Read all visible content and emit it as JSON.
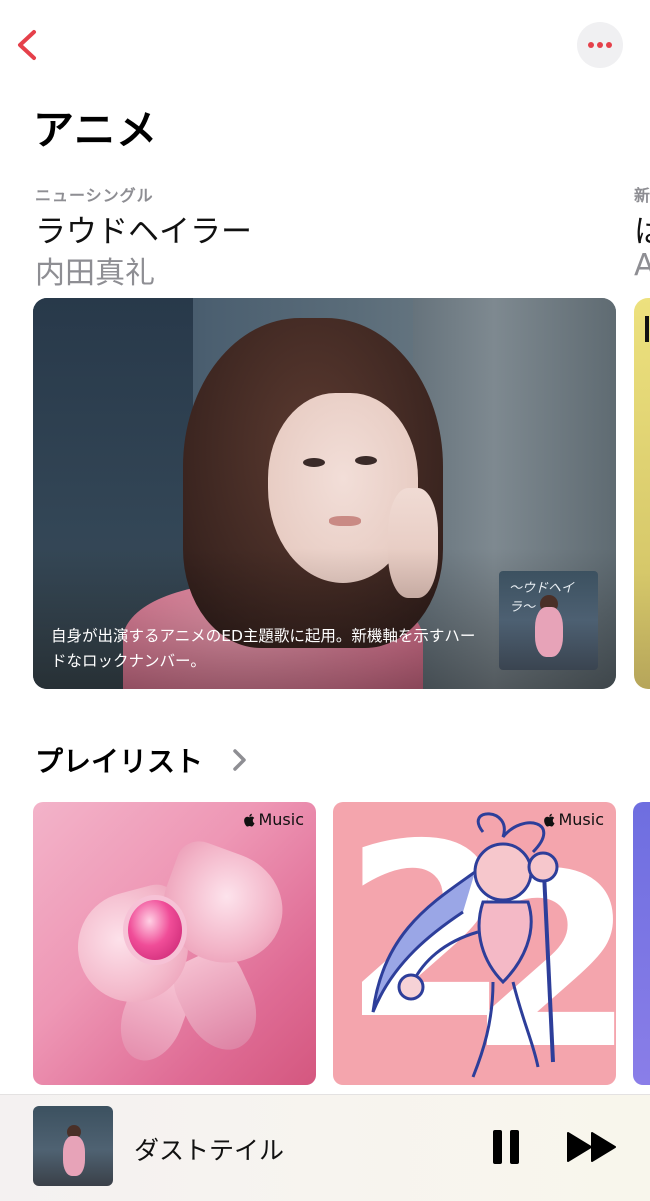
{
  "header": {
    "back_icon": "chevron-left-icon",
    "more_icon": "ellipsis-icon",
    "accent_color": "#e5404a",
    "title": "アニメ"
  },
  "featured": {
    "eyebrow": "ニューシングル",
    "title": "ラウドヘイラー",
    "artist": "内田真礼",
    "description": "自身が出演するアニメのED主題歌に起用。新機軸を示すハードなロックナンバー。",
    "peek": {
      "eyebrow": "新",
      "title": "は",
      "artist": "A"
    }
  },
  "playlists": {
    "title": "プレイリスト",
    "chevron_icon": "chevron-right-icon",
    "badge_label": "Music",
    "badge_icon": "apple-logo-icon"
  },
  "now_playing": {
    "title": "ダストテイル",
    "pause_icon": "pause-icon",
    "forward_icon": "fast-forward-icon"
  }
}
